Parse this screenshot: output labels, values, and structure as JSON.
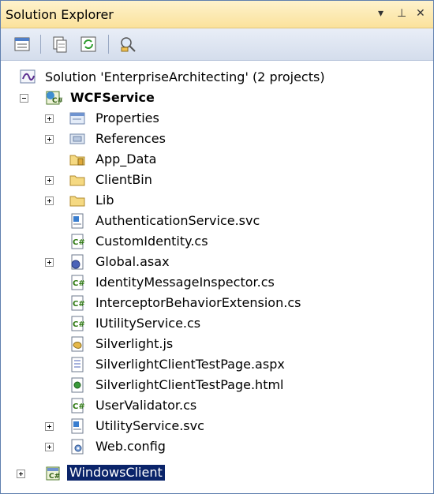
{
  "window": {
    "title": "Solution Explorer",
    "pin_glyph": "▾",
    "pin2_glyph": "⊥",
    "close_glyph": "✕"
  },
  "toolbar": {
    "buttons": [
      {
        "name": "properties-icon"
      },
      {
        "name": "show-all-files-icon"
      },
      {
        "name": "refresh-icon"
      },
      {
        "name": "view-class-diagram-icon"
      }
    ]
  },
  "tree": {
    "solution": "Solution 'EnterpriseArchitecting' (2 projects)",
    "project": "WCFService",
    "items": [
      "Properties",
      "References",
      "App_Data",
      "ClientBin",
      "Lib",
      "AuthenticationService.svc",
      "CustomIdentity.cs",
      "Global.asax",
      "IdentityMessageInspector.cs",
      "InterceptorBehaviorExtension.cs",
      "IUtilityService.cs",
      "Silverlight.js",
      "SilverlightClientTestPage.aspx",
      "SilverlightClientTestPage.html",
      "UserValidator.cs",
      "UtilityService.svc",
      "Web.config"
    ],
    "project2": "WindowsClient"
  }
}
